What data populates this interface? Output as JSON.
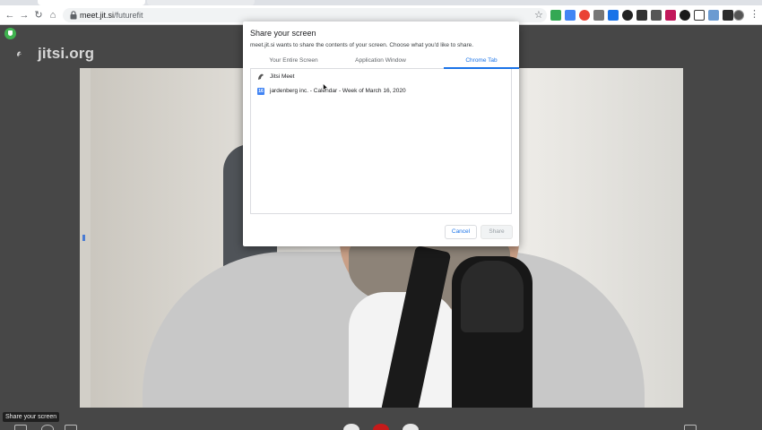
{
  "browser": {
    "url_host": "meet.jit.si",
    "url_path": "/futurefit"
  },
  "jitsi": {
    "logo_text": "jitsi.org"
  },
  "dialog": {
    "title": "Share your screen",
    "subtitle": "meet.jit.si wants to share the contents of your screen. Choose what you'd like to share.",
    "tabs": [
      {
        "label": "Your Entire Screen",
        "active": false
      },
      {
        "label": "Application Window",
        "active": false
      },
      {
        "label": "Chrome Tab",
        "active": true
      }
    ],
    "items": [
      {
        "label": "Jitsi Meet",
        "icon": "jitsi-icon"
      },
      {
        "label": "jardenberg inc. - Calendar - Week of March 16, 2020",
        "icon": "google-calendar-icon",
        "icon_text": "16"
      }
    ],
    "cancel_label": "Cancel",
    "share_label": "Share"
  },
  "toolbar": {
    "tooltip": "Share your screen"
  },
  "colors": {
    "accent": "#1a73e8",
    "hangup": "#c61a1a",
    "secure_badge": "#3fb24f"
  }
}
